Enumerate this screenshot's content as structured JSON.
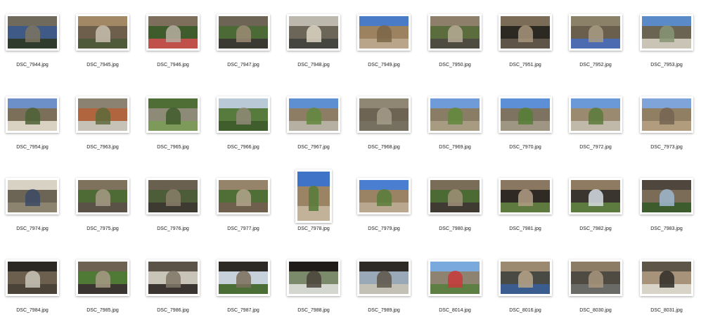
{
  "files": [
    {
      "name": "DSC_7944.jpg",
      "orientation": "landscape",
      "colors": [
        "#6f6a5c",
        "#3f5a86",
        "#7c7463",
        "#2f3b2c"
      ]
    },
    {
      "name": "DSC_7945.jpg",
      "orientation": "landscape",
      "colors": [
        "#a38866",
        "#6e5f4d",
        "#c9c0b0",
        "#4f5a3a"
      ]
    },
    {
      "name": "DSC_7946.jpg",
      "orientation": "landscape",
      "colors": [
        "#7d6f5b",
        "#3f5c2c",
        "#b7aea1",
        "#c0504a"
      ]
    },
    {
      "name": "DSC_7947.jpg",
      "orientation": "landscape",
      "colors": [
        "#6d6456",
        "#4c6a36",
        "#9b8b74",
        "#3a3a33"
      ]
    },
    {
      "name": "DSC_7948.jpg",
      "orientation": "landscape",
      "colors": [
        "#bdb8ad",
        "#6b6658",
        "#ddd6c4",
        "#45463f"
      ]
    },
    {
      "name": "DSC_7949.jpg",
      "orientation": "landscape",
      "colors": [
        "#4a7bc6",
        "#9c825e",
        "#7b6648",
        "#b9a58a"
      ]
    },
    {
      "name": "DSC_7950.jpg",
      "orientation": "landscape",
      "colors": [
        "#8d7f69",
        "#5b6d3c",
        "#b8ab95",
        "#4e4b41"
      ]
    },
    {
      "name": "DSC_7951.jpg",
      "orientation": "landscape",
      "colors": [
        "#7b6c58",
        "#2c2822",
        "#a8957b",
        "#5e5447"
      ]
    },
    {
      "name": "DSC_7952.jpg",
      "orientation": "landscape",
      "colors": [
        "#8b8068",
        "#6a5f4d",
        "#a89c84",
        "#4c6bb0"
      ]
    },
    {
      "name": "DSC_7953.jpg",
      "orientation": "landscape",
      "colors": [
        "#5b8ac8",
        "#6c6452",
        "#879474",
        "#c9c4b5"
      ]
    },
    {
      "name": "DSC_7954.jpg",
      "orientation": "landscape",
      "colors": [
        "#6e90c8",
        "#7c6f5a",
        "#4c6236",
        "#d9d2c2"
      ]
    },
    {
      "name": "DSC_7963.jpg",
      "orientation": "landscape",
      "colors": [
        "#8c8271",
        "#b0653f",
        "#5e6a3c",
        "#c7c2b8"
      ]
    },
    {
      "name": "DSC_7965.jpg",
      "orientation": "landscape",
      "colors": [
        "#4e6e35",
        "#8e8a78",
        "#3f5a2a",
        "#7d9a5a"
      ]
    },
    {
      "name": "DSC_7966.jpg",
      "orientation": "landscape",
      "colors": [
        "#b9c9d6",
        "#577a3d",
        "#8f8a77",
        "#3f5e2c"
      ]
    },
    {
      "name": "DSC_7967.jpg",
      "orientation": "landscape",
      "colors": [
        "#5e8fd0",
        "#8d7d64",
        "#62883f",
        "#b6b0a2"
      ]
    },
    {
      "name": "DSC_7968.jpg",
      "orientation": "landscape",
      "colors": [
        "#8f8673",
        "#6e6453",
        "#a59c88",
        "#75705f"
      ]
    },
    {
      "name": "DSC_7969.jpg",
      "orientation": "landscape",
      "colors": [
        "#6f9bd8",
        "#8a7d66",
        "#5f8a3b",
        "#a79b82"
      ]
    },
    {
      "name": "DSC_7970.jpg",
      "orientation": "landscape",
      "colors": [
        "#5c8fd6",
        "#7e7260",
        "#557f35",
        "#9f9583"
      ]
    },
    {
      "name": "DSC_7972.jpg",
      "orientation": "landscape",
      "colors": [
        "#6b99d8",
        "#9a8a70",
        "#5a7a3a",
        "#c0b8a8"
      ]
    },
    {
      "name": "DSC_7973.jpg",
      "orientation": "landscape",
      "colors": [
        "#7fa4d9",
        "#917f63",
        "#746450",
        "#b19c7e"
      ]
    },
    {
      "name": "DSC_7974.jpg",
      "orientation": "landscape",
      "colors": [
        "#d8d2c4",
        "#6c6455",
        "#3c4a66",
        "#8d846f"
      ]
    },
    {
      "name": "DSC_7975.jpg",
      "orientation": "landscape",
      "colors": [
        "#7f725d",
        "#4f6b35",
        "#a69a86",
        "#5a5247"
      ]
    },
    {
      "name": "DSC_7976.jpg",
      "orientation": "landscape",
      "colors": [
        "#6a604f",
        "#4d5d3a",
        "#8a7e69",
        "#3d3a32"
      ]
    },
    {
      "name": "DSC_7977.jpg",
      "orientation": "landscape",
      "colors": [
        "#95836a",
        "#4f6f36",
        "#b2a48c",
        "#6e604d"
      ]
    },
    {
      "name": "DSC_7978.jpg",
      "orientation": "portrait",
      "colors": [
        "#3f73c8",
        "#9b8463",
        "#567a38",
        "#c2b29a"
      ]
    },
    {
      "name": "DSC_7979.jpg",
      "orientation": "landscape",
      "colors": [
        "#4a7ed0",
        "#9a8365",
        "#587c3a",
        "#b9a88f"
      ]
    },
    {
      "name": "DSC_7980.jpg",
      "orientation": "landscape",
      "colors": [
        "#7a6d58",
        "#4c6a34",
        "#a08f78",
        "#3f3a32"
      ]
    },
    {
      "name": "DSC_7981.jpg",
      "orientation": "landscape",
      "colors": [
        "#8a7762",
        "#2f2a24",
        "#b29e85",
        "#5e7a3f"
      ]
    },
    {
      "name": "DSC_7982.jpg",
      "orientation": "landscape",
      "colors": [
        "#8e7b62",
        "#3a362f",
        "#d6dde4",
        "#5d7b3f"
      ]
    },
    {
      "name": "DSC_7983.jpg",
      "orientation": "landscape",
      "colors": [
        "#4f473d",
        "#7a6c57",
        "#9fb7cf",
        "#3d5c2e"
      ]
    },
    {
      "name": "DSC_7984.jpg",
      "orientation": "landscape",
      "colors": [
        "#2b2723",
        "#6c5f4e",
        "#c9c6b8",
        "#4b4338"
      ]
    },
    {
      "name": "DSC_7985.jpg",
      "orientation": "landscape",
      "colors": [
        "#6e6353",
        "#4f7a36",
        "#a79a84",
        "#3a3530"
      ]
    },
    {
      "name": "DSC_7986.jpg",
      "orientation": "landscape",
      "colors": [
        "#5b5347",
        "#c9c4b8",
        "#7f7566",
        "#3a3530"
      ]
    },
    {
      "name": "DSC_7987.jpg",
      "orientation": "landscape",
      "colors": [
        "#2d2a26",
        "#c7d1dc",
        "#7a6f5c",
        "#4a6e35"
      ]
    },
    {
      "name": "DSC_7988.jpg",
      "orientation": "landscape",
      "colors": [
        "#1f1c19",
        "#7c8a6c",
        "#4a4339",
        "#d4d6d0"
      ]
    },
    {
      "name": "DSC_7989.jpg",
      "orientation": "landscape",
      "colors": [
        "#2e2b27",
        "#9aa9b8",
        "#5d5649",
        "#c3c0b6"
      ]
    },
    {
      "name": "DSC_8014.jpg",
      "orientation": "landscape",
      "colors": [
        "#7aa9de",
        "#8e8270",
        "#c83a3a",
        "#5e7f44"
      ]
    },
    {
      "name": "DSC_8016.jpg",
      "orientation": "landscape",
      "colors": [
        "#9b8a70",
        "#4a4a45",
        "#b7a58a",
        "#3a5c8f"
      ]
    },
    {
      "name": "DSC_8030.jpg",
      "orientation": "landscape",
      "colors": [
        "#8c7c65",
        "#4f4a42",
        "#a9977c",
        "#6a6b66"
      ]
    },
    {
      "name": "DSC_8031.jpg",
      "orientation": "landscape",
      "colors": [
        "#5c5548",
        "#a7937a",
        "#2f2c27",
        "#d9d4c8"
      ]
    }
  ]
}
